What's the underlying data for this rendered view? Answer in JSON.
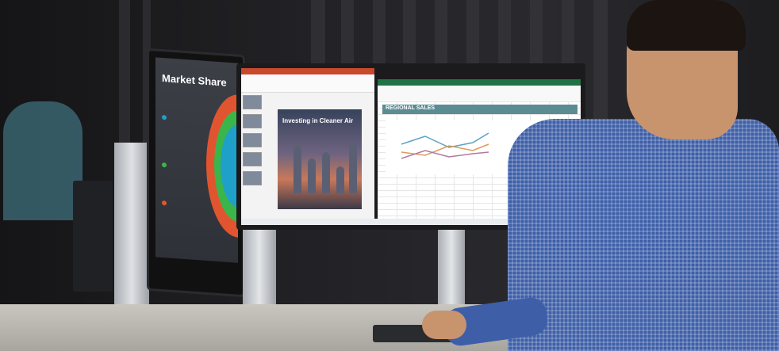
{
  "scene": {
    "description_free": true
  },
  "left_monitor": {
    "title": "Market Share",
    "legend": [
      {
        "color": "#1fa0c9"
      },
      {
        "color": "#3ab54a"
      },
      {
        "color": "#e0552f"
      }
    ]
  },
  "presentation": {
    "slide_title": "Investing in Cleaner Air"
  },
  "spreadsheet": {
    "header": "REGIONAL SALES"
  },
  "colors": {
    "ppt_accent": "#c8492b",
    "excel_accent": "#1f7244",
    "shirt": "#3e5fa8"
  }
}
